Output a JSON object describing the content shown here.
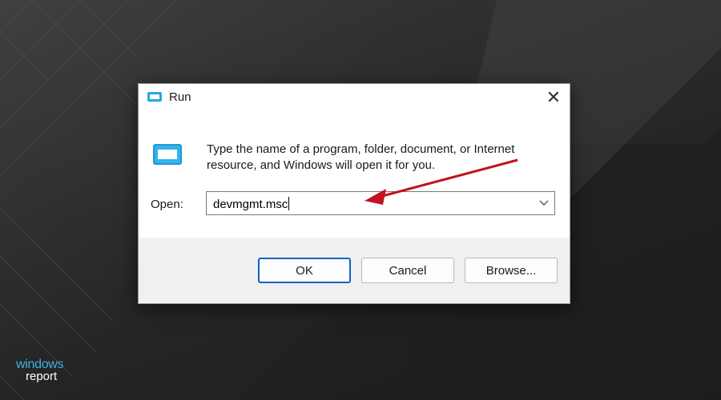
{
  "dialog": {
    "title": "Run",
    "description": "Type the name of a program, folder, document, or Internet resource, and Windows will open it for you.",
    "open_label": "Open:",
    "open_value": "devmgmt.msc",
    "buttons": {
      "ok": "OK",
      "cancel": "Cancel",
      "browse": "Browse..."
    }
  },
  "watermark": {
    "line1": "windows",
    "line2": "report"
  },
  "colors": {
    "accent": "#0a64c2",
    "arrow": "#c1121f",
    "watermark": "#3fb2e6"
  },
  "icons": [
    "run-icon",
    "close-icon",
    "chevron-down-icon"
  ]
}
